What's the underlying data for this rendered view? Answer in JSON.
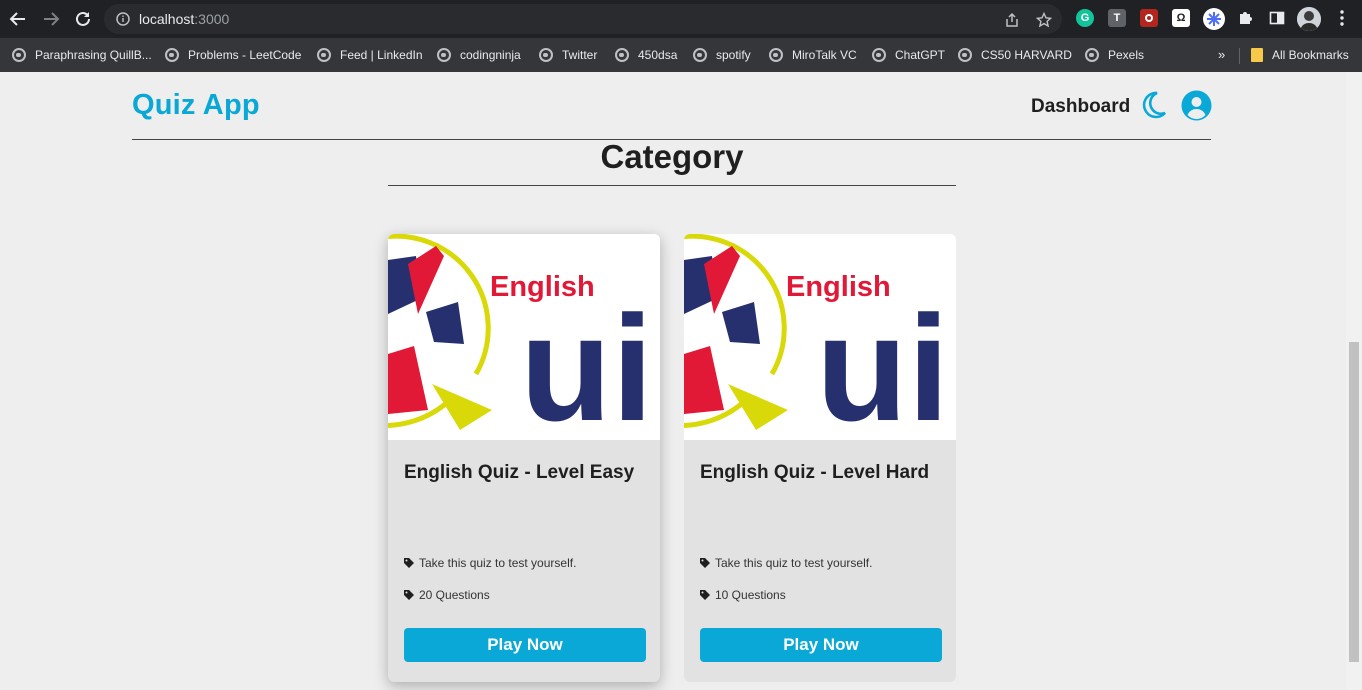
{
  "browser": {
    "url_host": "localhost",
    "url_port": ":3000",
    "bookmarks": [
      {
        "label": "Paraphrasing QuillB..."
      },
      {
        "label": "Problems - LeetCode"
      },
      {
        "label": "Feed | LinkedIn"
      },
      {
        "label": "codingninja"
      },
      {
        "label": "Twitter"
      },
      {
        "label": "450dsa"
      },
      {
        "label": "spotify"
      },
      {
        "label": "MiroTalk VC"
      },
      {
        "label": "ChatGPT"
      },
      {
        "label": "CS50 HARVARD"
      },
      {
        "label": "Pexels"
      }
    ],
    "more_label": "»",
    "all_bookmarks_label": "All Bookmarks",
    "extensions": [
      {
        "icon": "grammarly-icon",
        "letter": "G",
        "color": "#15c39a"
      },
      {
        "icon": "t-extension-icon",
        "letter": "T",
        "color": "#5f6368"
      },
      {
        "icon": "red-extension-icon",
        "letter": "",
        "color": "#d93025"
      },
      {
        "icon": "omega-extension-icon",
        "letter": "Ω",
        "color": "#ffffff"
      },
      {
        "icon": "snowflake-extension-icon",
        "letter": "",
        "color": "#4f6ef7"
      }
    ]
  },
  "header": {
    "brand": "Quiz App",
    "dashboard_label": "Dashboard",
    "accent_color": "#0aa8d6"
  },
  "main": {
    "title": "Category",
    "cards": [
      {
        "image_word_top": "English",
        "image_word_main": "ui",
        "title": "English Quiz - Level Easy",
        "description": "Take this quiz to test yourself.",
        "questions": "20 Questions",
        "button_label": "Play Now"
      },
      {
        "image_word_top": "English",
        "image_word_main": "ui",
        "title": "English Quiz - Level Hard",
        "description": "Take this quiz to test yourself.",
        "questions": "10 Questions",
        "button_label": "Play Now"
      }
    ]
  }
}
